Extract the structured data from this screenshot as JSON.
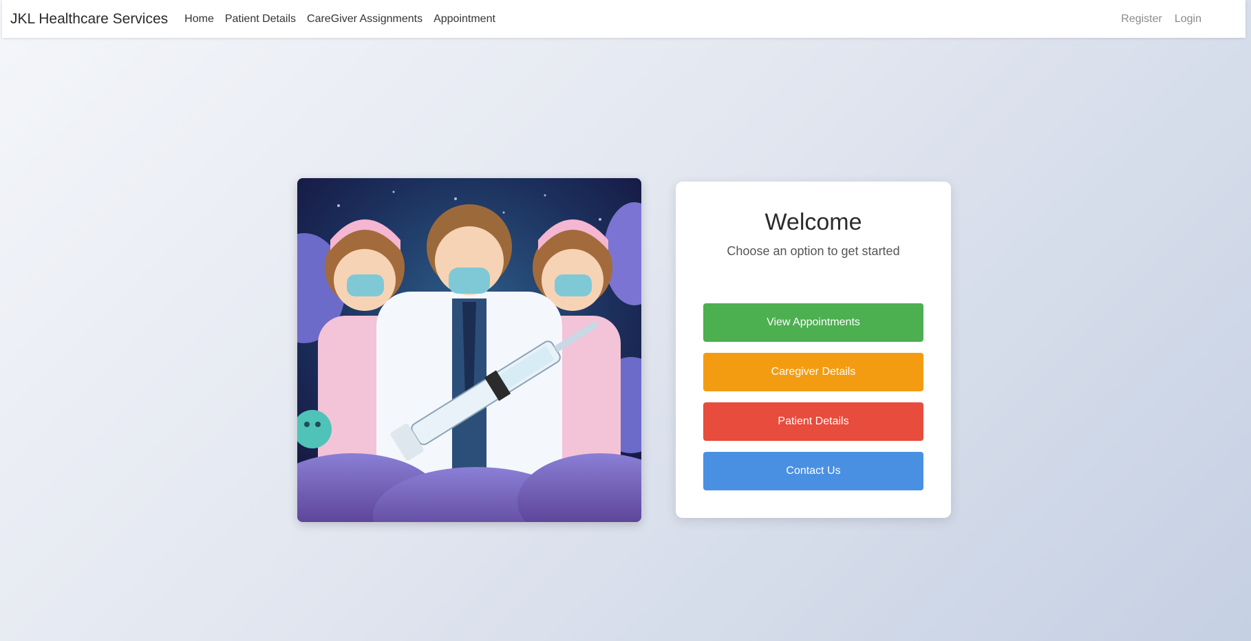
{
  "navbar": {
    "brand": "JKL Healthcare Services",
    "links": [
      "Home",
      "Patient Details",
      "CareGiver Assignments",
      "Appointment"
    ],
    "right_links": [
      "Register",
      "Login"
    ]
  },
  "card": {
    "title": "Welcome",
    "subtitle": "Choose an option to get started",
    "buttons": [
      {
        "label": "View Appointments",
        "color": "#4caf50"
      },
      {
        "label": "Caregiver Details",
        "color": "#f39c12"
      },
      {
        "label": "Patient Details",
        "color": "#e74c3c"
      },
      {
        "label": "Contact Us",
        "color": "#4a90e2"
      }
    ]
  },
  "hero": {
    "icon": "healthcare-workers-illustration"
  }
}
